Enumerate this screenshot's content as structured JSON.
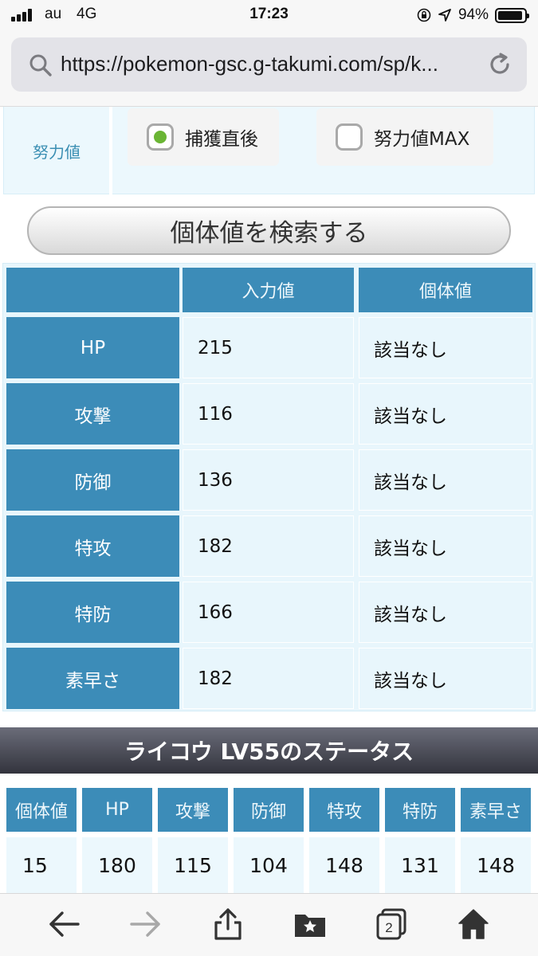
{
  "status_bar": {
    "carrier": "au",
    "network": "4G",
    "time": "17:23",
    "battery_text": "94%",
    "battery_level": 0.94
  },
  "browser": {
    "url": "https://pokemon-gsc.g-takumi.com/sp/k..."
  },
  "ev_section": {
    "label": "努力値",
    "options": [
      {
        "label": "捕獲直後",
        "checked": true
      },
      {
        "label": "努力値MAX",
        "checked": false
      }
    ]
  },
  "search_button": {
    "label": "個体値を検索する"
  },
  "iv_table": {
    "headers": [
      "",
      "入力値",
      "個体値"
    ],
    "rows": [
      {
        "stat": "HP",
        "input": "215",
        "iv": "該当なし"
      },
      {
        "stat": "攻撃",
        "input": "116",
        "iv": "該当なし"
      },
      {
        "stat": "防御",
        "input": "136",
        "iv": "該当なし"
      },
      {
        "stat": "特攻",
        "input": "182",
        "iv": "該当なし"
      },
      {
        "stat": "特防",
        "input": "166",
        "iv": "該当なし"
      },
      {
        "stat": "素早さ",
        "input": "182",
        "iv": "該当なし"
      }
    ]
  },
  "status_section": {
    "title": "ライコウ LV55のステータス",
    "headers": [
      "個体値",
      "HP",
      "攻撃",
      "防御",
      "特攻",
      "特防",
      "素早さ"
    ],
    "values": [
      "15",
      "180",
      "115",
      "104",
      "148",
      "131",
      "148"
    ]
  },
  "toolbar": {
    "tabs_count": "2"
  },
  "colors": {
    "table_header": "#3c8cb8",
    "table_cell": "#e8f6fc",
    "radio_checked": "#6ab534",
    "ev_label": "#3b8fb3"
  }
}
